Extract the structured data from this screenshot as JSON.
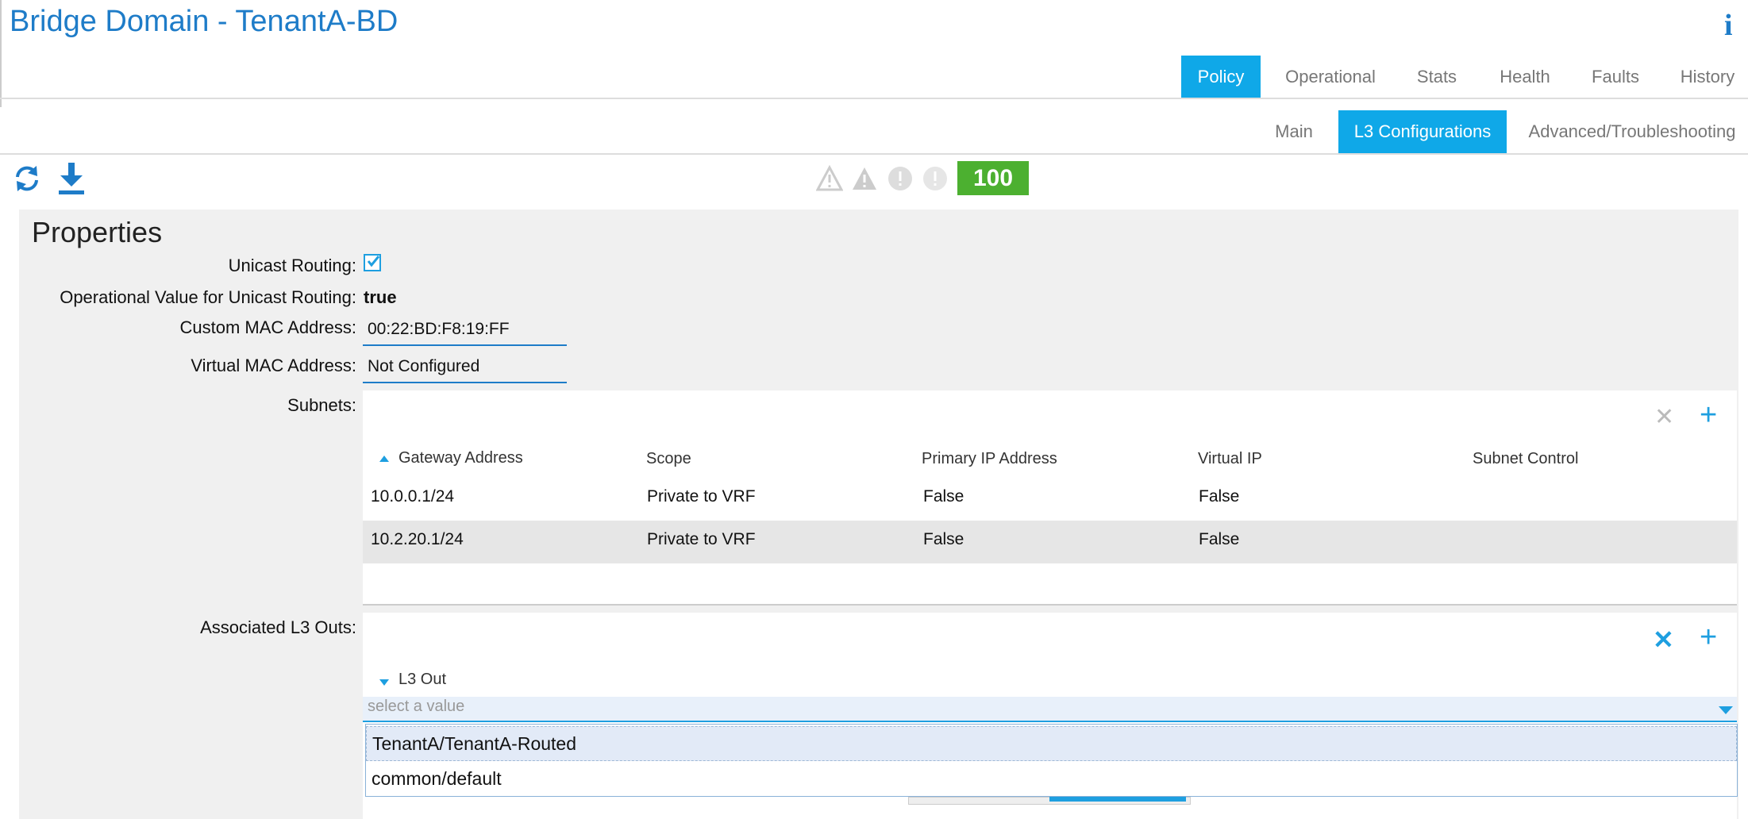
{
  "header": {
    "title": "Bridge Domain - TenantA-BD",
    "info_icon": "info-icon"
  },
  "top_tabs": [
    {
      "label": "Policy",
      "active": true
    },
    {
      "label": "Operational",
      "active": false
    },
    {
      "label": "Stats",
      "active": false
    },
    {
      "label": "Health",
      "active": false
    },
    {
      "label": "Faults",
      "active": false
    },
    {
      "label": "History",
      "active": false
    }
  ],
  "sub_tabs": [
    {
      "label": "Main",
      "active": false
    },
    {
      "label": "L3 Configurations",
      "active": true
    },
    {
      "label": "Advanced/Troubleshooting",
      "active": false
    }
  ],
  "toolbar": {
    "icons": [
      "refresh-icon",
      "download-icon"
    ]
  },
  "faults": {
    "icons": [
      "critical-warning-icon",
      "major-warning-icon",
      "minor-alert-icon",
      "info-alert-icon"
    ],
    "health_score": "100",
    "health_color": "#4cb030"
  },
  "properties": {
    "title": "Properties",
    "unicast_routing": {
      "label": "Unicast Routing:",
      "checked": true
    },
    "operational_unicast": {
      "label": "Operational Value for Unicast Routing:",
      "value": "true"
    },
    "custom_mac": {
      "label": "Custom MAC Address:",
      "value": "00:22:BD:F8:19:FF"
    },
    "virtual_mac": {
      "label": "Virtual MAC Address:",
      "value": "Not Configured"
    },
    "subnets": {
      "label": "Subnets:",
      "columns": [
        "Gateway Address",
        "Scope",
        "Primary IP Address",
        "Virtual IP",
        "Subnet Control"
      ],
      "rows": [
        [
          "10.0.0.1/24",
          "Private to VRF",
          "False",
          "False",
          ""
        ],
        [
          "10.2.20.1/24",
          "Private to VRF",
          "False",
          "False",
          ""
        ]
      ]
    },
    "l3outs": {
      "label": "Associated L3 Outs:",
      "column": "L3 Out",
      "placeholder": "select a value",
      "options": [
        "TenantA/TenantA-Routed",
        "common/default"
      ]
    }
  },
  "colors": {
    "accent": "#1e7cc8",
    "tab_active": "#0fa8e8",
    "health_green": "#4cb030"
  }
}
